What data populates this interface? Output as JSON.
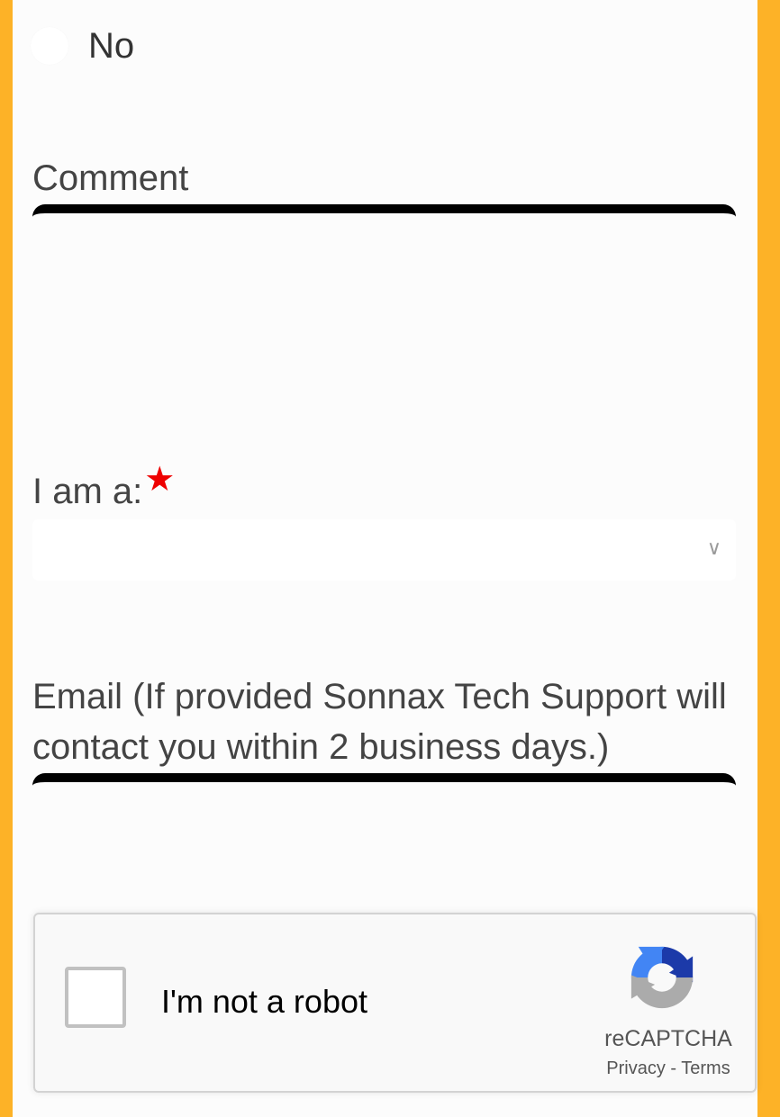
{
  "radio_option": {
    "label": "No"
  },
  "comment": {
    "label": "Comment",
    "value": ""
  },
  "role": {
    "label": "I am a:",
    "required_mark": "★",
    "selected": "",
    "chevron": "∨"
  },
  "email": {
    "label": "Email (If provided Sonnax Tech Support will contact you within 2 business days.)",
    "value": ""
  },
  "recaptcha": {
    "checkbox_label": "I'm not a robot",
    "brand": "reCAPTCHA",
    "privacy": "Privacy",
    "separator": " - ",
    "terms": "Terms"
  },
  "colors": {
    "page_background": "#FDB227",
    "panel_background": "#FCFCFC",
    "required_star": "#EE0000",
    "recaptcha_blue_dark": "#1C3AA9",
    "recaptcha_blue_light": "#4285F4",
    "recaptcha_gray": "#ABABAB"
  }
}
